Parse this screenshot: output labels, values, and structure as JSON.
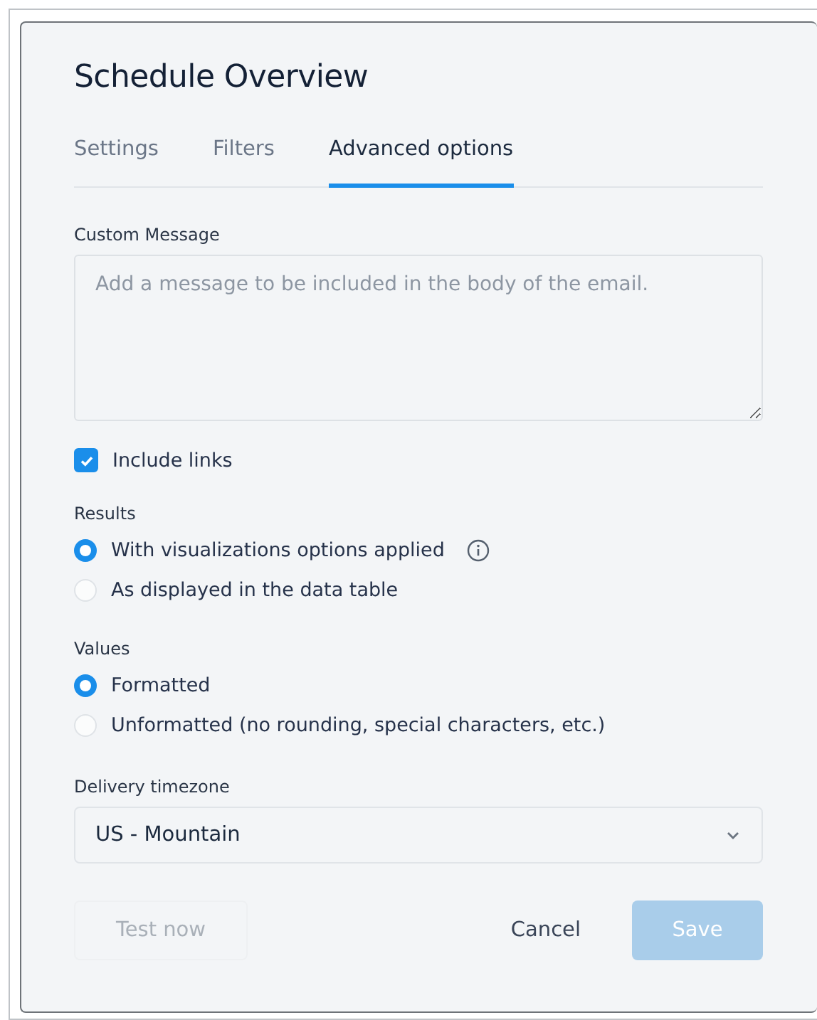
{
  "dialog": {
    "title": "Schedule Overview"
  },
  "tabs": [
    {
      "label": "Settings",
      "selected": false
    },
    {
      "label": "Filters",
      "selected": false
    },
    {
      "label": "Advanced options",
      "selected": true
    }
  ],
  "custom_message": {
    "label": "Custom Message",
    "placeholder": "Add a message to be included in the body of the email."
  },
  "include_links": {
    "label": "Include links",
    "checked": true
  },
  "groups": [
    {
      "label": "Results",
      "options": [
        {
          "label": "With visualizations options applied",
          "selected": true,
          "info": true
        },
        {
          "label": "As displayed in the data table",
          "selected": false,
          "info": false
        }
      ]
    },
    {
      "label": "Values",
      "options": [
        {
          "label": "Formatted",
          "selected": true,
          "info": false
        },
        {
          "label": "Unformatted (no rounding, special characters, etc.)",
          "selected": false,
          "info": false
        }
      ]
    }
  ],
  "timezone": {
    "label": "Delivery timezone",
    "value": "US - Mountain"
  },
  "buttons": [
    {
      "label": "Test now",
      "kind": "secondary",
      "disabled": true
    },
    {
      "label": "Cancel",
      "kind": "link",
      "disabled": false
    },
    {
      "label": "Save",
      "kind": "primary",
      "disabled": true
    }
  ]
}
